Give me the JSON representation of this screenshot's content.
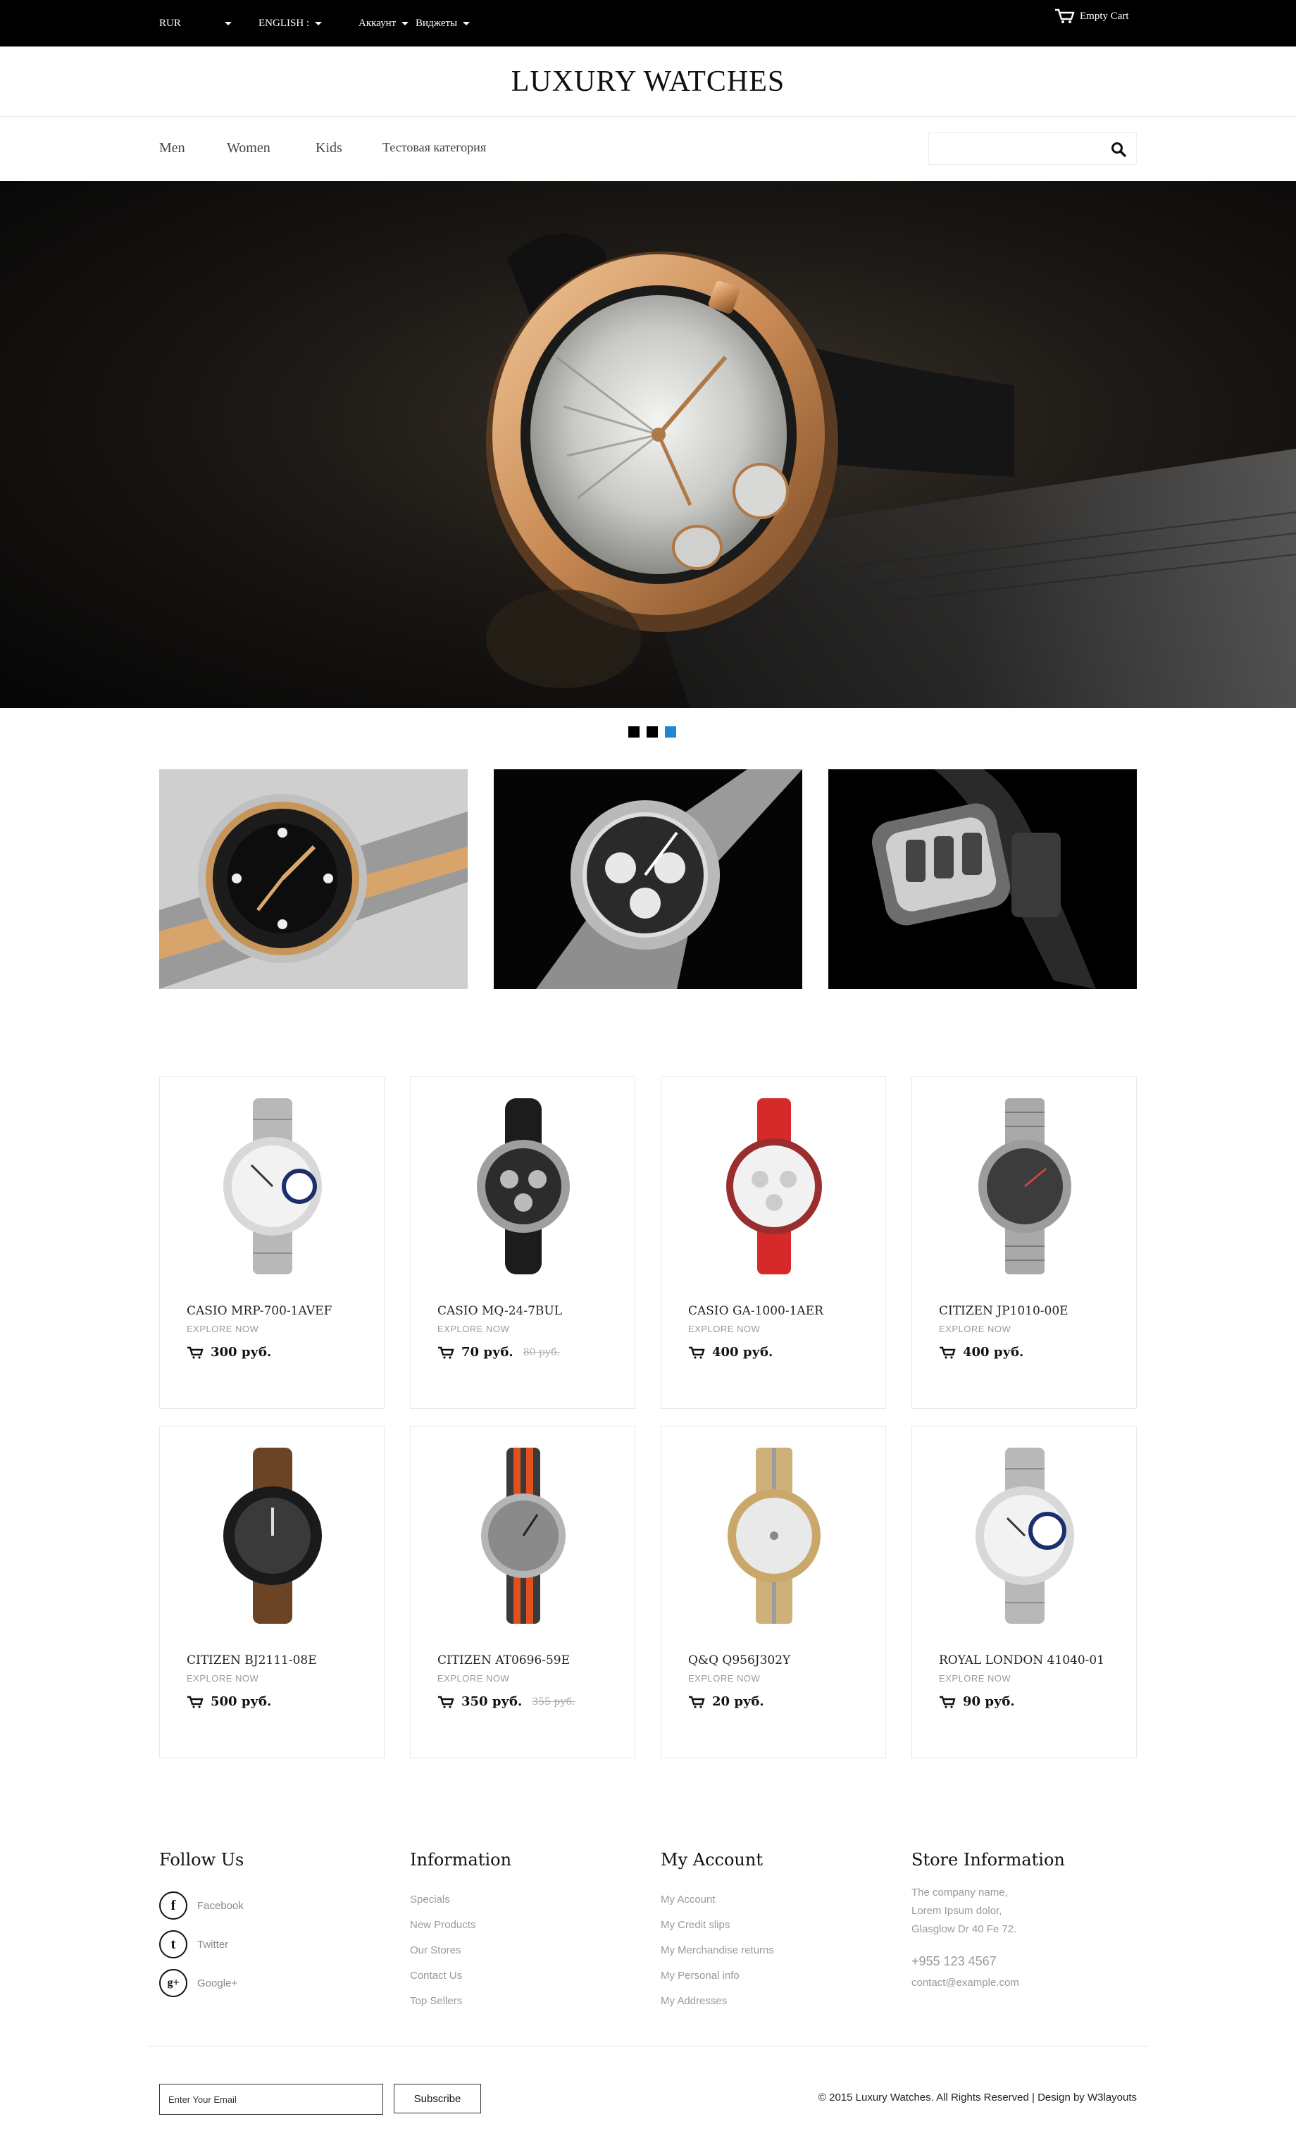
{
  "topbar": {
    "currency": "RUR",
    "language": "ENGLISH :",
    "account": "Аккаунт",
    "widgets": "Виджеты",
    "cart": "Empty Cart"
  },
  "header": {
    "brand": "LUXURY WATCHES"
  },
  "nav": {
    "items": [
      "Men",
      "Women",
      "Kids",
      "Тестовая категория"
    ]
  },
  "slider": {
    "dots": 3,
    "active_dot": 3
  },
  "products": [
    {
      "name": "CASIO MRP-700-1AVEF",
      "explore": "EXPLORE NOW",
      "price": "300 руб.",
      "old_price": ""
    },
    {
      "name": "CASIO MQ-24-7BUL",
      "explore": "EXPLORE NOW",
      "price": "70 руб.",
      "old_price": "80 руб."
    },
    {
      "name": "CASIO GA-1000-1AER",
      "explore": "EXPLORE NOW",
      "price": "400 руб.",
      "old_price": ""
    },
    {
      "name": "CITIZEN JP1010-00E",
      "explore": "EXPLORE NOW",
      "price": "400 руб.",
      "old_price": ""
    },
    {
      "name": "CITIZEN BJ2111-08E",
      "explore": "EXPLORE NOW",
      "price": "500 руб.",
      "old_price": ""
    },
    {
      "name": "CITIZEN AT0696-59E",
      "explore": "EXPLORE NOW",
      "price": "350 руб.",
      "old_price": "355 руб."
    },
    {
      "name": "Q&Q Q956J302Y",
      "explore": "EXPLORE NOW",
      "price": "20 руб.",
      "old_price": ""
    },
    {
      "name": "ROYAL LONDON 41040-01",
      "explore": "EXPLORE NOW",
      "price": "90 руб.",
      "old_price": ""
    }
  ],
  "footer": {
    "follow": {
      "title": "Follow Us",
      "items": [
        {
          "label": "Facebook",
          "glyph": "f"
        },
        {
          "label": "Twitter",
          "glyph": "t"
        },
        {
          "label": "Google+",
          "glyph": "g+"
        }
      ]
    },
    "information": {
      "title": "Information",
      "links": [
        "Specials",
        "New Products",
        "Our Stores",
        "Contact Us",
        "Top Sellers"
      ]
    },
    "account": {
      "title": "My Account",
      "links": [
        "My Account",
        "My Credit slips",
        "My Merchandise returns",
        "My Personal info",
        "My Addresses"
      ]
    },
    "store": {
      "title": "Store Information",
      "lines": [
        "The company name,",
        "Lorem Ipsum dolor,",
        "Glasglow Dr 40 Fe 72."
      ],
      "phone": "+955 123 4567",
      "email": "contact@example.com"
    },
    "newsletter": {
      "placeholder": "Enter Your Email",
      "button": "Subscribe"
    },
    "copyright": "© 2015 Luxury Watches. All Rights Reserved | Design by W3layouts"
  }
}
